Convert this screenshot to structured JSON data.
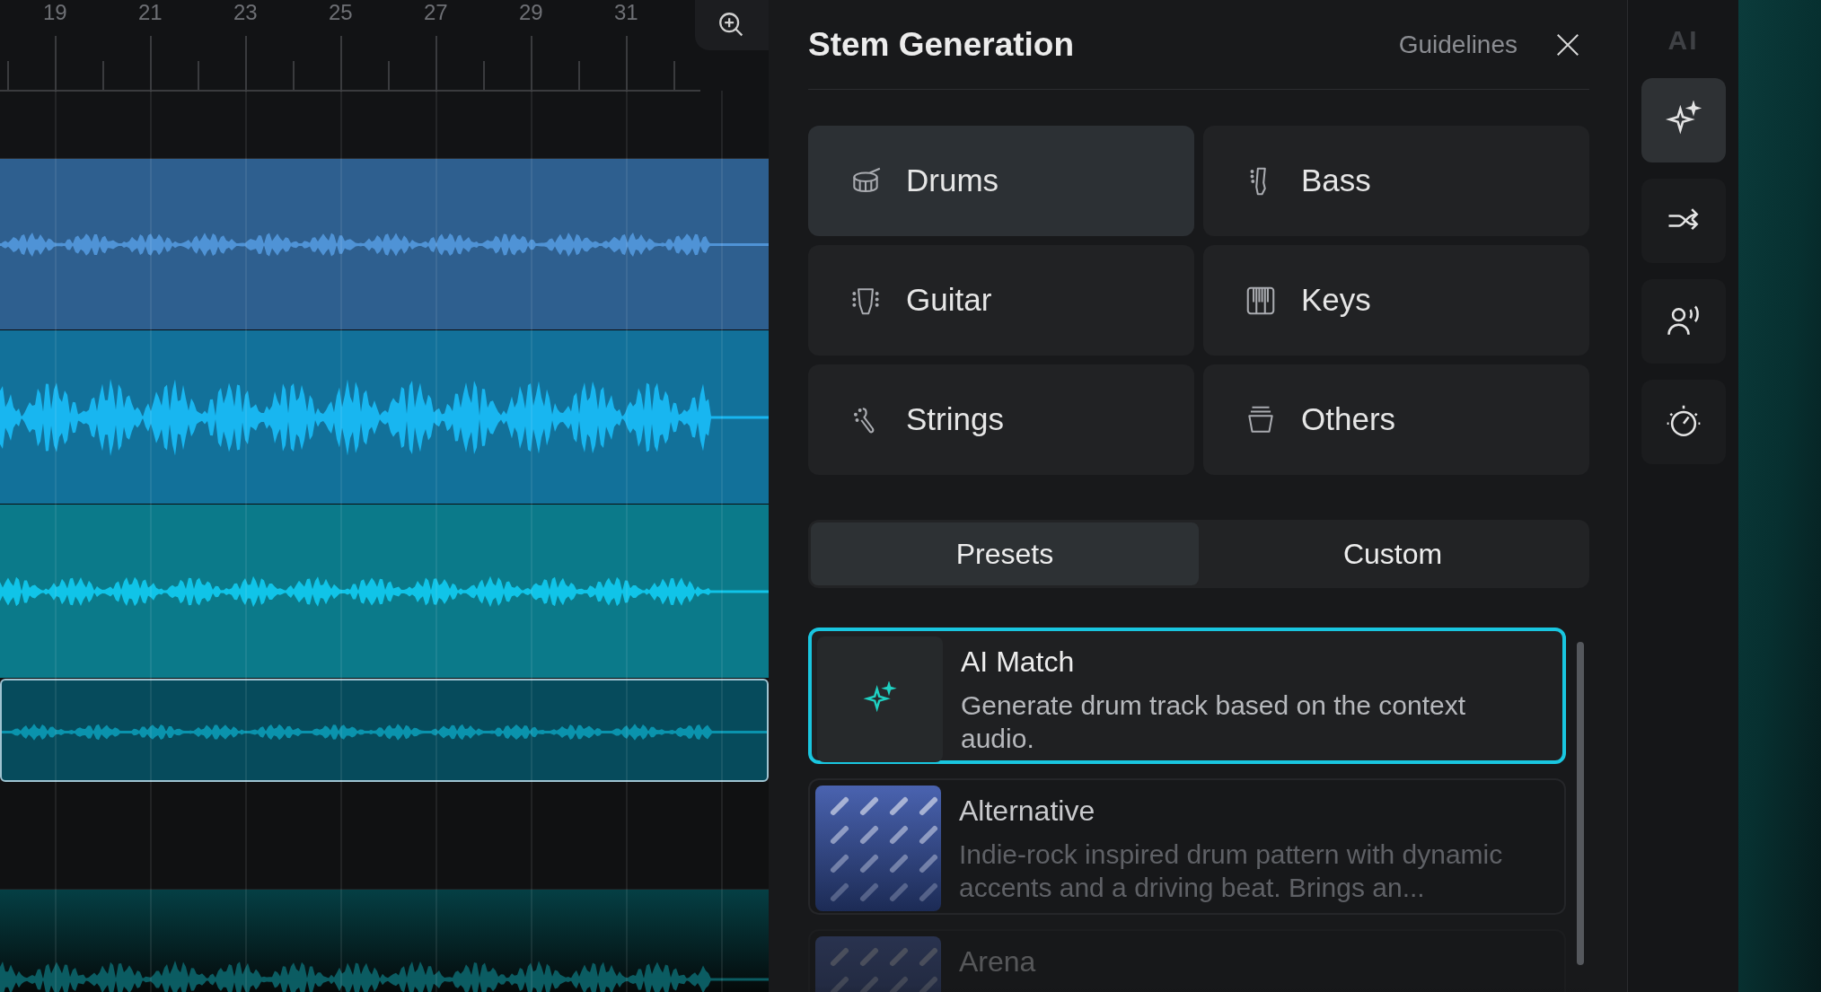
{
  "timeline": {
    "ruler_labels": [
      "19",
      "21",
      "23",
      "25",
      "27",
      "29",
      "31"
    ],
    "tracks": [
      {
        "color": "#2e5f8f",
        "selected": false
      },
      {
        "color": "#12719a",
        "selected": false
      },
      {
        "color": "#0b7a8a",
        "selected": false
      },
      {
        "color": "#064b5c",
        "selected": true
      },
      {
        "color": "#053f44",
        "selected": false
      }
    ]
  },
  "panel": {
    "title": "Stem Generation",
    "guidelines": "Guidelines",
    "instruments": [
      {
        "label": "Drums",
        "selected": true
      },
      {
        "label": "Bass",
        "selected": false
      },
      {
        "label": "Guitar",
        "selected": false
      },
      {
        "label": "Keys",
        "selected": false
      },
      {
        "label": "Strings",
        "selected": false
      },
      {
        "label": "Others",
        "selected": false
      }
    ],
    "tabs": [
      {
        "label": "Presets",
        "selected": true
      },
      {
        "label": "Custom",
        "selected": false
      }
    ],
    "presets": [
      {
        "kind": "sparkle",
        "title": "AI Match",
        "description": "Generate drum track based on the context audio.",
        "selected": true
      },
      {
        "kind": "picture",
        "title": "Alternative",
        "description": "Indie-rock inspired drum pattern with dynamic accents and a driving beat. Brings an...",
        "selected": false
      },
      {
        "kind": "picture",
        "title": "Arena",
        "selected": false
      }
    ]
  },
  "rail": {
    "label": "AI",
    "tools": [
      {
        "selected": true
      },
      {
        "selected": false
      },
      {
        "selected": false
      },
      {
        "selected": false
      }
    ]
  }
}
